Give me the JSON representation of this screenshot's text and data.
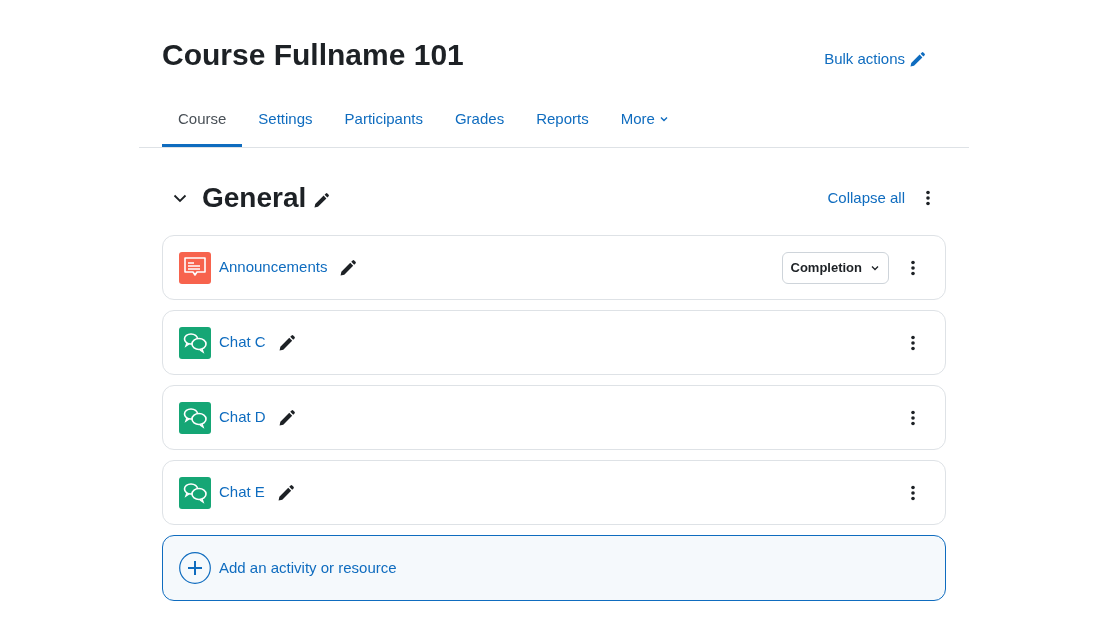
{
  "page_title": "Course Fullname 101",
  "bulk_actions": "Bulk actions",
  "tabs": [
    {
      "label": "Course",
      "selected": true,
      "dropdown": false
    },
    {
      "label": "Settings",
      "selected": false,
      "dropdown": false
    },
    {
      "label": "Participants",
      "selected": false,
      "dropdown": false
    },
    {
      "label": "Grades",
      "selected": false,
      "dropdown": false
    },
    {
      "label": "Reports",
      "selected": false,
      "dropdown": false
    },
    {
      "label": "More",
      "selected": false,
      "dropdown": true
    }
  ],
  "section": {
    "title": "General",
    "expanded": true,
    "collapse_all": "Collapse all"
  },
  "activities": [
    {
      "kind": "forum",
      "name": "Announcements",
      "completion": "Completion"
    },
    {
      "kind": "chat",
      "name": "Chat C"
    },
    {
      "kind": "chat",
      "name": "Chat D"
    },
    {
      "kind": "chat",
      "name": "Chat E"
    }
  ],
  "add_activity": "Add an activity or resource"
}
